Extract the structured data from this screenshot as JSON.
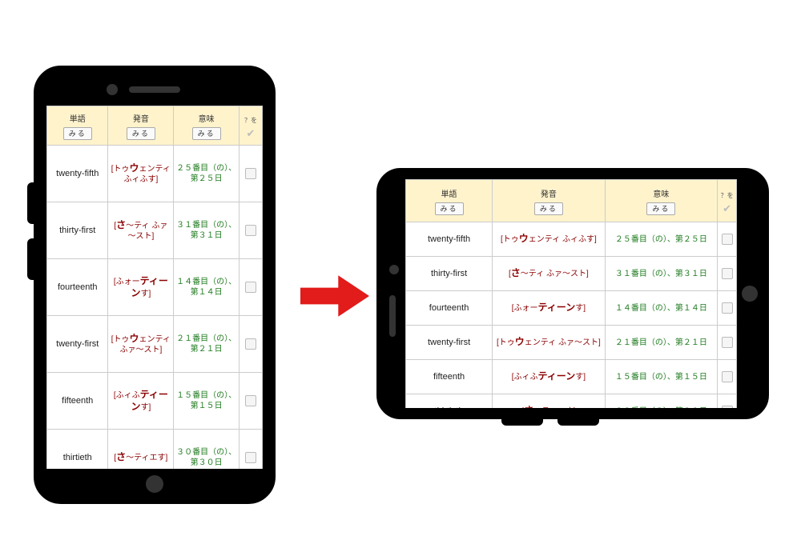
{
  "headers": {
    "word_label": "単語",
    "pron_label": "発音",
    "mean_label": "意味",
    "show_btn": "みる",
    "check_hint": "？を"
  },
  "rows": [
    {
      "word": "twenty-fifth",
      "pron_pre": "[トゥ",
      "pron_em": "ウ",
      "pron_post": "ェンティ ふィふす]",
      "meaning": "２５番目（の）、第２５日"
    },
    {
      "word": "thirty-first",
      "pron_pre": "[",
      "pron_em": "さ",
      "pron_post": "～ティ ふァ～スト]",
      "meaning": "３１番目（の）、第３１日"
    },
    {
      "word": "fourteenth",
      "pron_pre": "[ふォー",
      "pron_em": "ティーン",
      "pron_post": "す]",
      "meaning": "１４番目（の）、第１４日"
    },
    {
      "word": "twenty-first",
      "pron_pre": "[トゥ",
      "pron_em": "ウ",
      "pron_post": "ェンティ ふァ～スト]",
      "meaning": "２１番目（の）、第２１日"
    },
    {
      "word": "fifteenth",
      "pron_pre": "[ふィふ",
      "pron_em": "ティーン",
      "pron_post": "す]",
      "meaning": "１５番目（の）、第１５日"
    },
    {
      "word": "thirtieth",
      "pron_pre": "[",
      "pron_em": "さ",
      "pron_post": "～ティエす]",
      "meaning": "３０番目（の）、第３０日"
    }
  ]
}
